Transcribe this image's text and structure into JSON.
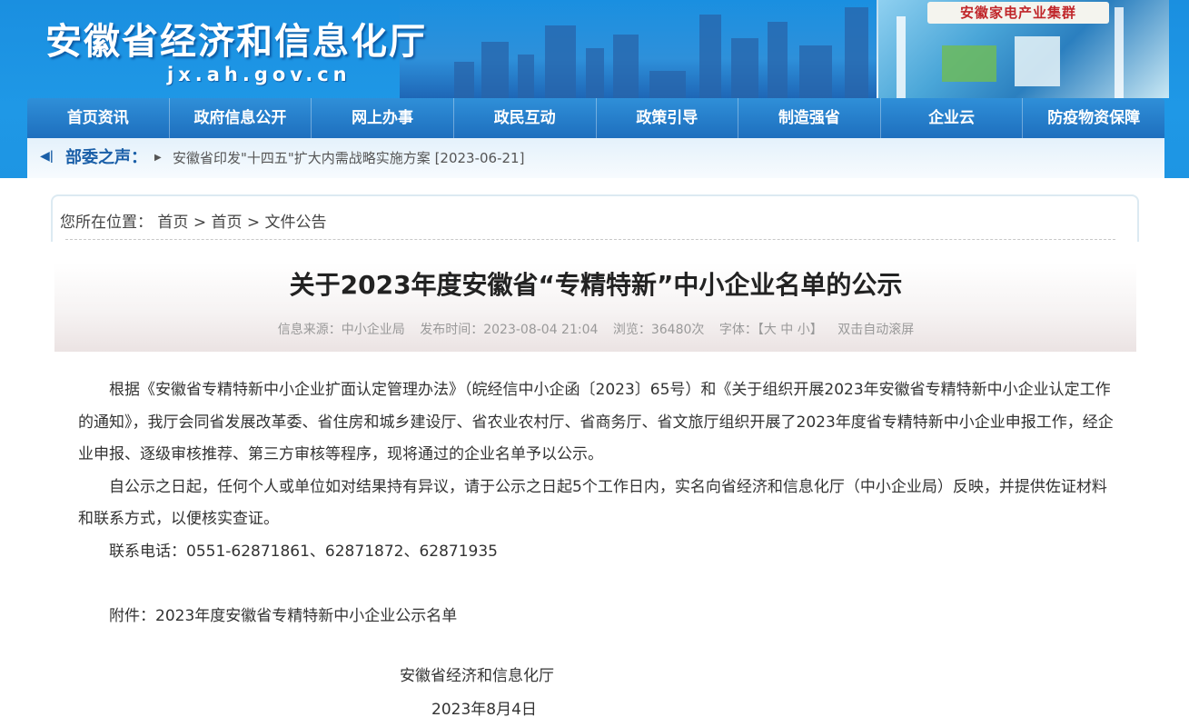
{
  "site": {
    "title": "安徽省经济和信息化厅",
    "domain": "jx.ah.gov.cn",
    "banner_sign": "安徽家电产业集群"
  },
  "nav": {
    "items": [
      {
        "label": "首页资讯"
      },
      {
        "label": "政府信息公开"
      },
      {
        "label": "网上办事"
      },
      {
        "label": "政民互动"
      },
      {
        "label": "政策引导"
      },
      {
        "label": "制造强省"
      },
      {
        "label": "企业云"
      },
      {
        "label": "防疫物资保障"
      }
    ]
  },
  "announce": {
    "label": "部委之声：",
    "link": "安徽省印发\"十四五\"扩大内需战略实施方案 [2023-06-21]"
  },
  "breadcrumb": {
    "prefix": "您所在位置：",
    "items": [
      "首页",
      "首页",
      "文件公告"
    ],
    "separator": ">"
  },
  "article": {
    "title": "关于2023年度安徽省“专精特新”中小企业名单的公示",
    "meta": {
      "source": "信息来源：中小企业局",
      "published": "发布时间：2023-08-04 21:04",
      "views": "浏览：36480次",
      "font_label": "字体：",
      "font_sizes": "【大 中 小】",
      "autoscroll": "双击自动滚屏"
    },
    "paragraphs": [
      "根据《安徽省专精特新中小企业扩面认定管理办法》（皖经信中小企函〔2023〕65号）和《关于组织开展2023年安徽省专精特新中小企业认定工作的通知》，我厅会同省发展改革委、省住房和城乡建设厅、省农业农村厅、省商务厅、省文旅厅组织开展了2023年度省专精特新中小企业申报工作，经企业申报、逐级审核推荐、第三方审核等程序，现将通过的企业名单予以公示。",
      "自公示之日起，任何个人或单位如对结果持有异议，请于公示之日起5个工作日内，实名向省经济和信息化厅（中小企业局）反映，并提供佐证材料和联系方式，以便核实查证。",
      "联系电话：0551-62871861、62871872、62871935"
    ],
    "attachment": "附件：2023年度安徽省专精特新中小企业公示名单",
    "signature_org": "安徽省经济和信息化厅",
    "signature_date": "2023年8月4日"
  }
}
